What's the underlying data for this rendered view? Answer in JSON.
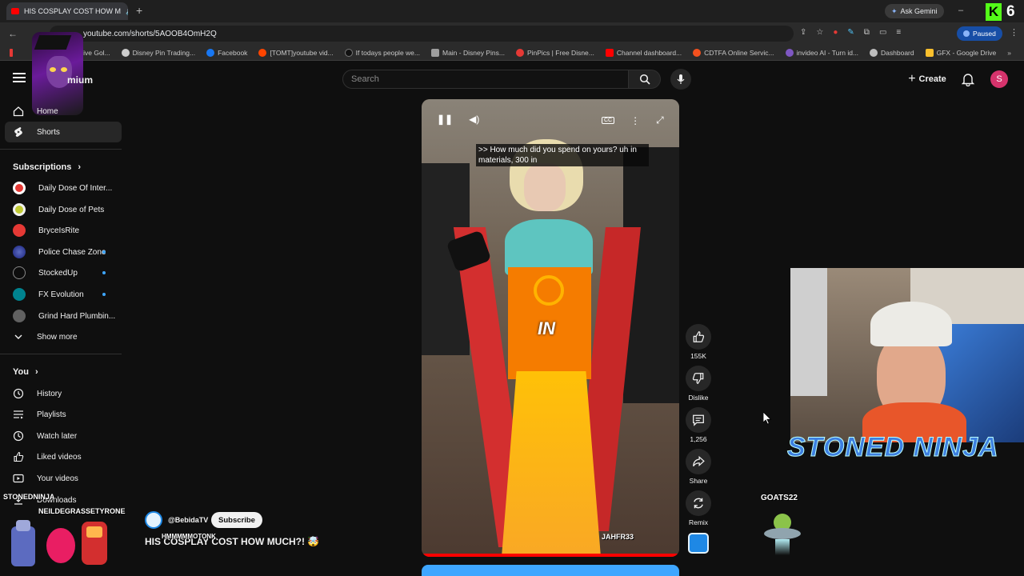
{
  "browser": {
    "tab_title": "HIS COSPLAY COST HOW M",
    "url": "youtube.com/shorts/5AOOB4OmH2Q",
    "gemini": "Ask Gemini",
    "profile_status": "Paused",
    "bookmarks": [
      "omprehensive Gol...",
      "Disney Pin Trading...",
      "Facebook",
      "[TOMT]youtube vid...",
      "If todays people we...",
      "Main - Disney Pins...",
      "PinPics | Free Disne...",
      "Channel dashboard...",
      "CDTFA Online Servic...",
      "invideo AI - Turn id...",
      "Dashboard",
      "GFX - Google Drive"
    ]
  },
  "header": {
    "logo_suffix": "mium",
    "search_placeholder": "Search",
    "create_label": "Create",
    "avatar_letter": "S"
  },
  "sidebar": {
    "home": "Home",
    "shorts": "Shorts",
    "subscriptions_title": "Subscriptions",
    "channels": [
      {
        "name": "Daily Dose Of Inter...",
        "color": "#e53935",
        "dot": false
      },
      {
        "name": "Daily Dose of Pets",
        "color": "#c0ca33",
        "dot": false
      },
      {
        "name": "BryceIsRite",
        "color": "#e53935",
        "dot": false
      },
      {
        "name": "Police Chase Zone",
        "color": "#3949ab",
        "dot": true
      },
      {
        "name": "StockedUp",
        "color": "#0d0d0d",
        "dot": true
      },
      {
        "name": "FX Evolution",
        "color": "#00838f",
        "dot": true
      },
      {
        "name": "Grind Hard Plumbin...",
        "color": "#616161",
        "dot": false
      }
    ],
    "show_more": "Show more",
    "you_title": "You",
    "you_items": [
      "History",
      "Playlists",
      "Watch later",
      "Liked videos",
      "Your videos",
      "Downloads"
    ]
  },
  "video": {
    "caption": ">> How much did you spend on yours? uh in materials, 300 in",
    "center_word": "IN",
    "channel": "@BebidaTV",
    "subscribe": "Subscribe",
    "title": "HIS COSPLAY COST HOW MUCH?! 🤯",
    "watermark": "JAHFR33"
  },
  "actions": {
    "likes": "155K",
    "dislike": "Dislike",
    "comments": "1,256",
    "share": "Share",
    "remix": "Remix"
  },
  "overlay": {
    "streamer_name": "STONED NINJA",
    "tag_left": "STONEDNINJA",
    "tag_left2": "NEILDEGRASSETYRONE",
    "tag_mid": "HMMMMMOTONK",
    "tag_right": "GOATS22",
    "counter": "6"
  },
  "colors": {
    "yt_red": "#ff0000",
    "accent_blue": "#3ea6ff",
    "kick_green": "#53fc18"
  }
}
